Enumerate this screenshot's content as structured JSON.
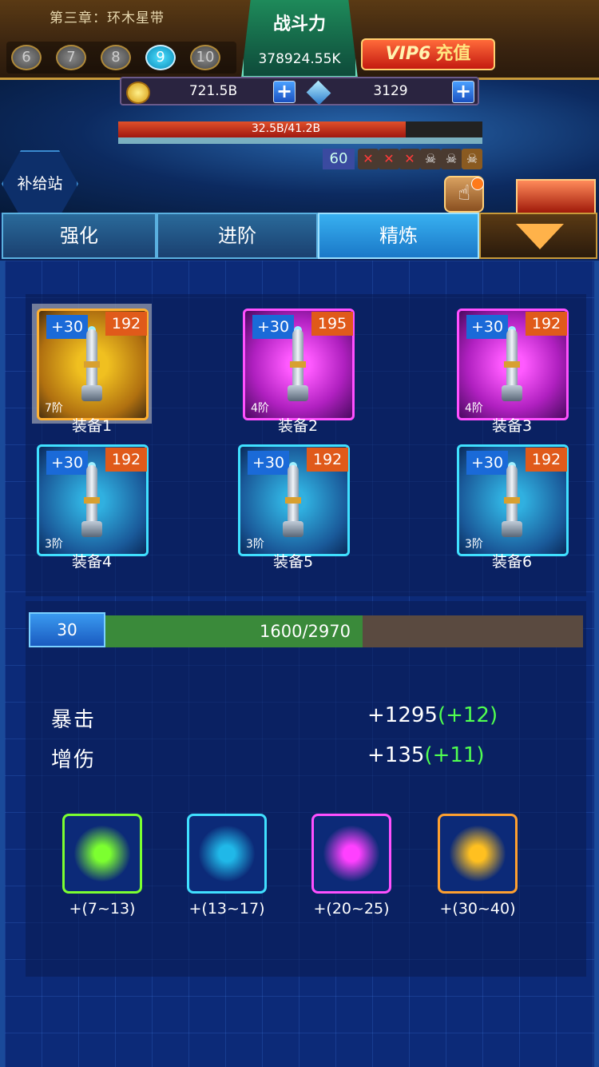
{
  "header": {
    "chapter": "第三章：环木星带",
    "stages": [
      "6",
      "7",
      "8",
      "9",
      "10"
    ],
    "active_stage": "9",
    "power_title": "战斗力",
    "power_value": "378924.55K",
    "vip_label": "VIP6",
    "recharge_label": "充值"
  },
  "currency": {
    "gold": "721.5B",
    "gems": "3129",
    "plus": "+"
  },
  "battle": {
    "boss_hp_text": "32.5B/41.2B",
    "boss_hp_fraction": 0.79,
    "wave": "60",
    "supply_label": "补给站"
  },
  "tabs": [
    {
      "label": "强化"
    },
    {
      "label": "进阶"
    },
    {
      "label": "精炼"
    }
  ],
  "active_tab": "精炼",
  "equipment": [
    {
      "plus": "+30",
      "level": "192",
      "tier": "7阶",
      "name": "装备1",
      "quality": "gold",
      "selected": true
    },
    {
      "plus": "+30",
      "level": "195",
      "tier": "4阶",
      "name": "装备2",
      "quality": "purple",
      "selected": false
    },
    {
      "plus": "+30",
      "level": "192",
      "tier": "4阶",
      "name": "装备3",
      "quality": "purple",
      "selected": false
    },
    {
      "plus": "+30",
      "level": "192",
      "tier": "3阶",
      "name": "装备4",
      "quality": "cyan",
      "selected": false
    },
    {
      "plus": "+30",
      "level": "192",
      "tier": "3阶",
      "name": "装备5",
      "quality": "cyan",
      "selected": false
    },
    {
      "plus": "+30",
      "level": "192",
      "tier": "3阶",
      "name": "装备6",
      "quality": "cyan",
      "selected": false
    }
  ],
  "refine": {
    "level": "30",
    "progress_text": "1600/2970",
    "progress_fraction": 0.539,
    "stats": [
      {
        "name": "暴击",
        "value": "+1295",
        "bonus": "(+12)"
      },
      {
        "name": "增伤",
        "value": "+135",
        "bonus": "(+11)"
      }
    ],
    "gems": [
      {
        "range": "+(7~13)",
        "color": "#7cff30",
        "border": "#7cff30"
      },
      {
        "range": "+(13~17)",
        "color": "#20b8e8",
        "border": "#40e0ff"
      },
      {
        "range": "+(20~25)",
        "color": "#ff40ff",
        "border": "#ff50ff"
      },
      {
        "range": "+(30~40)",
        "color": "#ffc020",
        "border": "#ffa030"
      }
    ]
  }
}
